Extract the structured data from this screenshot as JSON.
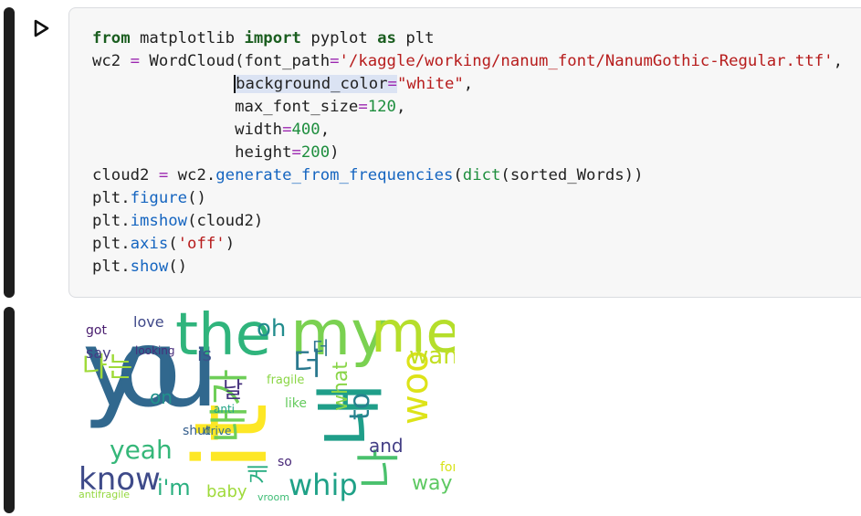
{
  "code_cell": {
    "lines": [
      [
        {
          "t": "from",
          "c": "kw"
        },
        {
          "t": " matplotlib "
        },
        {
          "t": "import",
          "c": "kw"
        },
        {
          "t": " pyplot "
        },
        {
          "t": "as",
          "c": "kw"
        },
        {
          "t": " plt"
        }
      ],
      [
        {
          "t": "wc2 "
        },
        {
          "t": "=",
          "c": "op"
        },
        {
          "t": " WordCloud(font_path"
        },
        {
          "t": "=",
          "c": "op"
        },
        {
          "t": "'/kaggle/working/nanum_font/NanumGothic-Regular.ttf'",
          "c": "str"
        },
        {
          "t": ","
        }
      ],
      [
        {
          "t": "               "
        },
        {
          "t": "background_color",
          "c": "sel cursor"
        },
        {
          "t": "=",
          "c": "op sel"
        },
        {
          "t": "\"white\"",
          "c": "str"
        },
        {
          "t": ","
        }
      ],
      [
        {
          "t": "               max_font_size"
        },
        {
          "t": "=",
          "c": "op"
        },
        {
          "t": "120",
          "c": "num"
        },
        {
          "t": ","
        }
      ],
      [
        {
          "t": "               width"
        },
        {
          "t": "=",
          "c": "op"
        },
        {
          "t": "400",
          "c": "num"
        },
        {
          "t": ","
        }
      ],
      [
        {
          "t": "               height"
        },
        {
          "t": "=",
          "c": "op"
        },
        {
          "t": "200",
          "c": "num"
        },
        {
          "t": ")"
        }
      ],
      [
        {
          "t": "cloud2 "
        },
        {
          "t": "=",
          "c": "op"
        },
        {
          "t": " wc2."
        },
        {
          "t": "generate_from_frequencies",
          "c": "fn"
        },
        {
          "t": "("
        },
        {
          "t": "dict",
          "c": "num"
        },
        {
          "t": "(sorted_Words))"
        }
      ],
      [
        {
          "t": "plt."
        },
        {
          "t": "figure",
          "c": "fn"
        },
        {
          "t": "()"
        }
      ],
      [
        {
          "t": "plt."
        },
        {
          "t": "imshow",
          "c": "fn"
        },
        {
          "t": "(cloud2)"
        }
      ],
      [
        {
          "t": "plt."
        },
        {
          "t": "axis",
          "c": "fn"
        },
        {
          "t": "("
        },
        {
          "t": "'off'",
          "c": "str"
        },
        {
          "t": ")"
        }
      ],
      [
        {
          "t": "plt."
        },
        {
          "t": "show",
          "c": "fn"
        },
        {
          "t": "()"
        }
      ]
    ]
  },
  "wordcloud": {
    "words": [
      {
        "text": "you",
        "color": "#31688e"
      },
      {
        "text": "it",
        "color": "#fde725"
      },
      {
        "text": "my",
        "color": "#7ad151"
      },
      {
        "text": "me",
        "color": "#b5de2b"
      },
      {
        "text": "the",
        "color": "#2fb47c"
      },
      {
        "text": "나는",
        "color": "#a0da39"
      },
      {
        "text": "내",
        "color": "#1f9e89"
      },
      {
        "text": "내가",
        "color": "#6ece58"
      },
      {
        "text": "나",
        "color": "#4ac16d"
      },
      {
        "text": "know",
        "color": "#3e4a89"
      },
      {
        "text": "yeah",
        "color": "#35b779"
      },
      {
        "text": "whip",
        "color": "#1fa187"
      },
      {
        "text": "woo",
        "color": "#dde318"
      },
      {
        "text": "want",
        "color": "#c2df23"
      },
      {
        "text": "to",
        "color": "#26828e"
      },
      {
        "text": "is",
        "color": "#3b528b"
      },
      {
        "text": "on",
        "color": "#21918c"
      },
      {
        "text": "what",
        "color": "#89d548"
      },
      {
        "text": "더",
        "color": "#2a788e"
      },
      {
        "text": "so",
        "color": "#482878"
      },
      {
        "text": "way",
        "color": "#5ec962"
      },
      {
        "text": "baby",
        "color": "#9fda3a"
      },
      {
        "text": "i'm",
        "color": "#29af7f"
      },
      {
        "text": "and",
        "color": "#433e85"
      },
      {
        "text": "love",
        "color": "#3f4889"
      },
      {
        "text": "looking",
        "color": "#472d7b"
      },
      {
        "text": "say",
        "color": "#443b84"
      },
      {
        "text": "oh",
        "color": "#228c8d"
      },
      {
        "text": "날",
        "color": "#46327e"
      },
      {
        "text": "게",
        "color": "#27ad81"
      },
      {
        "text": "for",
        "color": "#d8e219"
      },
      {
        "text": "like",
        "color": "#65cb5e"
      },
      {
        "text": "shut",
        "color": "#355f8d"
      },
      {
        "text": "drive",
        "color": "#2e6e8e"
      },
      {
        "text": "anti",
        "color": "#20a486"
      },
      {
        "text": "vroom",
        "color": "#3dbc74"
      },
      {
        "text": "antifragile",
        "color": "#95d840"
      },
      {
        "text": "got",
        "color": "#481c6e"
      },
      {
        "text": "fragile",
        "color": "#8bd646"
      },
      {
        "text": "더",
        "color": "#2c728e"
      }
    ]
  }
}
